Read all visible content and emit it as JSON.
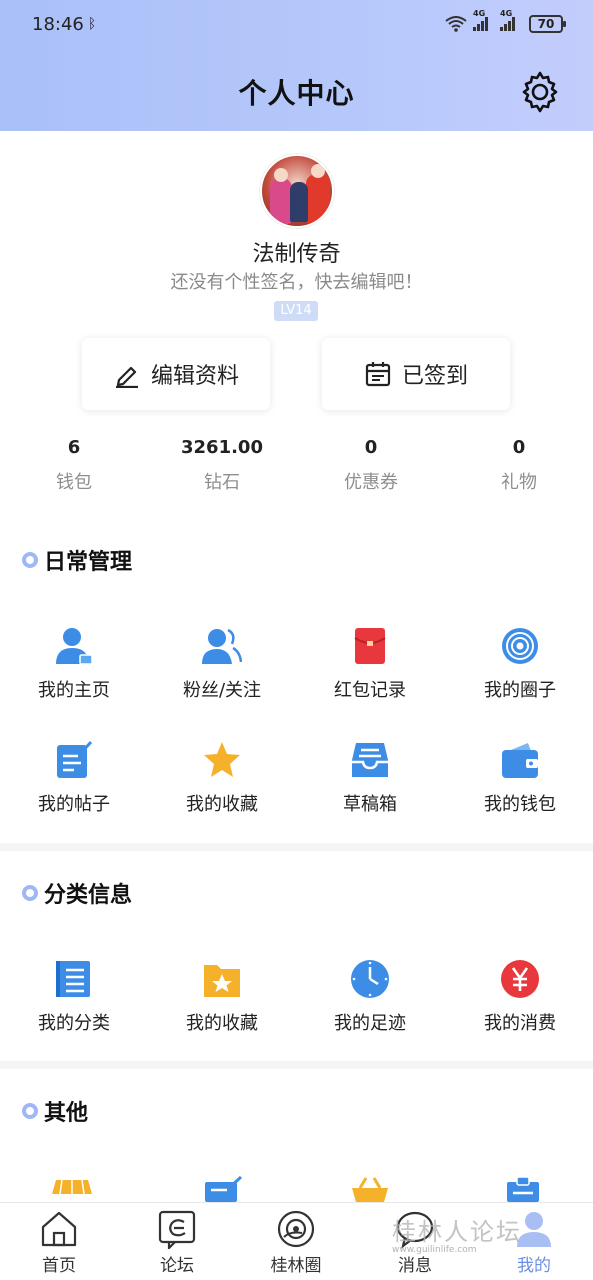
{
  "status_bar": {
    "time": "18:46",
    "battery": "70",
    "net1": "4G",
    "net2": "4G"
  },
  "header": {
    "title": "个人中心"
  },
  "profile": {
    "name": "法制传奇",
    "signature": "还没有个性签名，快去编辑吧！",
    "level": "LV14"
  },
  "actions": {
    "edit_label": "编辑资料",
    "signin_label": "已签到"
  },
  "stats": [
    {
      "value": "6",
      "label": "钱包"
    },
    {
      "value": "3261.00",
      "label": "钻石"
    },
    {
      "value": "0",
      "label": "优惠券"
    },
    {
      "value": "0",
      "label": "礼物"
    }
  ],
  "sections": {
    "daily": {
      "title": "日常管理",
      "items": [
        {
          "label": "我的主页",
          "icon": "user-home-icon"
        },
        {
          "label": "粉丝/关注",
          "icon": "fans-icon"
        },
        {
          "label": "红包记录",
          "icon": "red-envelope-icon"
        },
        {
          "label": "我的圈子",
          "icon": "circle-icon"
        },
        {
          "label": "我的帖子",
          "icon": "post-icon"
        },
        {
          "label": "我的收藏",
          "icon": "star-icon"
        },
        {
          "label": "草稿箱",
          "icon": "drafts-icon"
        },
        {
          "label": "我的钱包",
          "icon": "wallet-icon"
        }
      ]
    },
    "category": {
      "title": "分类信息",
      "items": [
        {
          "label": "我的分类",
          "icon": "category-icon"
        },
        {
          "label": "我的收藏",
          "icon": "folder-star-icon"
        },
        {
          "label": "我的足迹",
          "icon": "clock-icon"
        },
        {
          "label": "我的消费",
          "icon": "yuan-icon"
        }
      ]
    },
    "other": {
      "title": "其他"
    }
  },
  "tabbar": [
    {
      "label": "首页"
    },
    {
      "label": "论坛"
    },
    {
      "label": "桂林圈"
    },
    {
      "label": "消息"
    },
    {
      "label": "我的"
    }
  ],
  "watermark": {
    "text": "桂林人论坛",
    "sub": "www.guilinlife.com"
  },
  "colors": {
    "accent": "#6b8fe8",
    "header_start": "#a9c0f8",
    "icon_blue": "#3d8de6",
    "icon_red": "#e8383d",
    "icon_orange": "#f5b12a"
  }
}
